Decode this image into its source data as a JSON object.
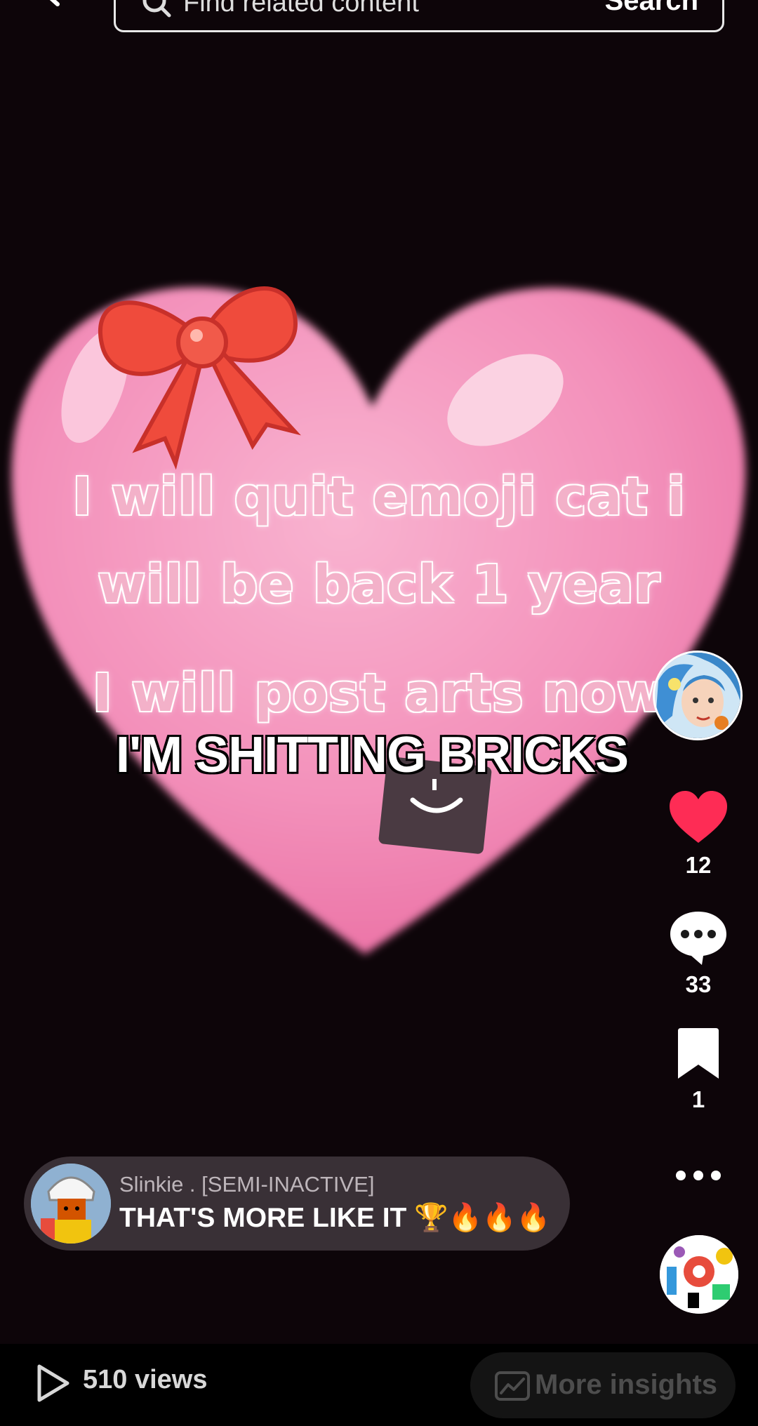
{
  "search": {
    "placeholder": "Find related content",
    "button_label": "Search"
  },
  "video": {
    "overlay_lines": [
      "I will quit emoji cat i",
      "will be back 1 year",
      "I will post arts now"
    ],
    "caption": "I'M SHITTING BRICKS"
  },
  "rail": {
    "likes": "12",
    "comments": "33",
    "saves": "1"
  },
  "comment": {
    "username": "Slinkie . [SEMI-INACTIVE]",
    "text": "THAT'S MORE LIKE IT 🏆🔥🔥🔥"
  },
  "bottom_bar": {
    "views": "510 views",
    "insights_label": "More insights"
  },
  "colors": {
    "like_red": "#fe2c55",
    "heart_pink": "#f59ac0",
    "bow_red": "#ef4b3c"
  }
}
